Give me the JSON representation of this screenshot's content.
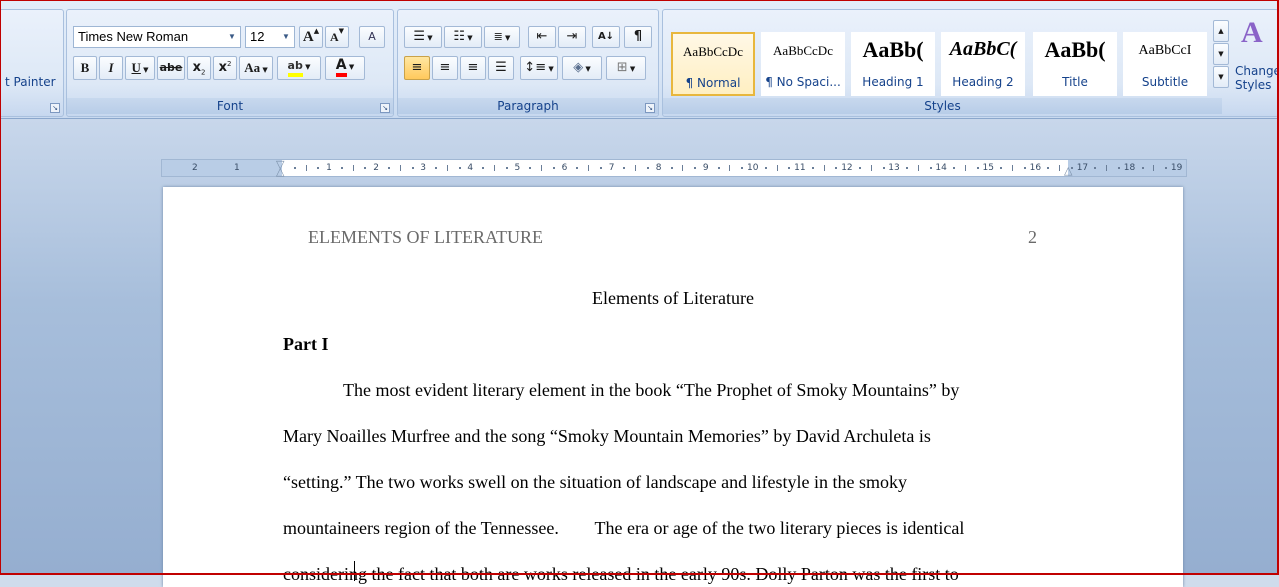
{
  "ribbon": {
    "clipboard": {
      "format_painter": "t Painter"
    },
    "font": {
      "label": "Font",
      "font_name": "Times New Roman",
      "font_size": "12",
      "grow": "A",
      "shrink": "A",
      "clear": "A",
      "bold": "B",
      "italic": "I",
      "underline": "U",
      "strike": "abe",
      "subscript": "x",
      "superscript": "x",
      "change_case": "Aa",
      "highlight": "ab",
      "font_color": "A"
    },
    "paragraph": {
      "label": "Paragraph",
      "sort": "A↓",
      "pilcrow": "¶"
    },
    "styles": {
      "label": "Styles",
      "tiles": [
        {
          "sample": "AaBbCcDc",
          "name": "¶ Normal"
        },
        {
          "sample": "AaBbCcDc",
          "name": "¶ No Spaci..."
        },
        {
          "sample": "AaBb(",
          "name": "Heading 1"
        },
        {
          "sample": "AaBbC(",
          "name": "Heading 2"
        },
        {
          "sample": "AaBb(",
          "name": "Title"
        },
        {
          "sample": "AaBbCcI",
          "name": "Subtitle"
        }
      ],
      "change_styles": "Change Styles"
    },
    "colors": {
      "highlight": "#ffff00",
      "font": "#ff0000",
      "group_label": "#15428b"
    }
  },
  "ruler": {
    "numbers_left": [
      "2",
      "1"
    ],
    "numbers": [
      "1",
      "2",
      "3",
      "4",
      "5",
      "6",
      "7",
      "8",
      "9",
      "10",
      "11",
      "12",
      "13",
      "14",
      "15",
      "16",
      "17",
      "18",
      "19"
    ]
  },
  "document": {
    "running_head": "ELEMENTS OF LITERATURE",
    "page_number": "2",
    "title": "Elements of Literature",
    "part": "Part I",
    "lines": [
      "The most evident literary element in the book “The Prophet of Smoky Mountains” by",
      "Mary Noailles Murfree and the song “Smoky Mountain Memories” by David Archuleta is",
      "“setting.” The two works swell on the situation of landscape and lifestyle in the smoky",
      "mountaineers region of the Tennessee.        The era or age of the two literary pieces is identical",
      "considering the fact that both are works released in the early 90s. Dolly Parton was the first to"
    ]
  }
}
